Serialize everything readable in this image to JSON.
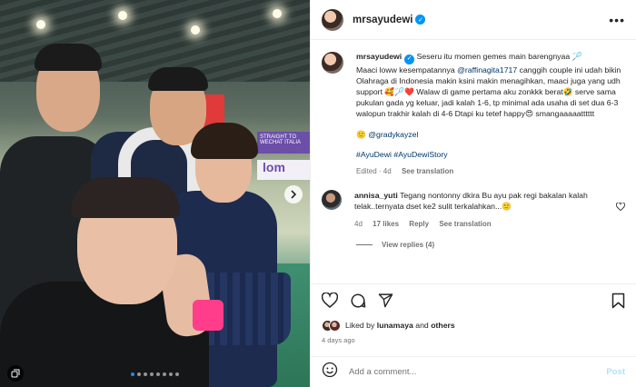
{
  "post": {
    "username": "mrsayudewi",
    "caption_segments": {
      "line_a": "Seseru itu momen gemes main barengnyaa 🏸",
      "line_b": "Maaci loww kesempatannya ",
      "mention_raffi": "@raffinagita1717",
      "line_c": " canggih couple ini udah bikin Olahraga di Indonesia makin ksini makin menagihkan, maaci juga yang udh support 🥰🏸❤️ Walaw di game pertama aku zonkkk berat🤣 serve sama pukulan gada yg keluar, jadi kalah 1-6, tp minimal ada usaha di set dua 6-3 walopun trakhir kalah di 4-6 Dtapi ku tetef happy😍 smangaaaaatttttt",
      "line_d": "🙂 ",
      "mention_grady": "@gradykayzel",
      "hashtags": "#AyuDewi #AyuDewiStory"
    },
    "caption_meta": {
      "edited": "Edited · 4d",
      "see_translation": "See translation"
    }
  },
  "comments": [
    {
      "username": "annisa_yuti",
      "text": "Tegang nontonny dkira Bu ayu pak regi bakalan kalah telak..ternyata dset ke2 sulit terkalahkan...🙂",
      "age": "4d",
      "likes": "17 likes",
      "reply": "Reply",
      "see_translation": "See translation",
      "view_replies": "View replies (4)"
    }
  ],
  "likes": {
    "prefix": "Liked by ",
    "user": "lunamaya",
    "mid": " and ",
    "others": "others"
  },
  "timestamp": "4 days ago",
  "add_comment": {
    "placeholder": "Add a comment...",
    "post_label": "Post"
  },
  "photo": {
    "banner_text": "STRAIGHT TO WECHAT ITALIA",
    "banner_brand": "lom",
    "carousel_count": 8,
    "carousel_active": 0
  },
  "colors": {
    "link": "#00376b",
    "verified": "#0095f6",
    "post_disabled": "#b2dffc",
    "wristband": "#ff3d8b"
  },
  "icons": [
    "more-icon",
    "verified-icon",
    "heart-icon",
    "comment-icon",
    "share-icon",
    "bookmark-icon",
    "emoji-icon",
    "next-arrow-icon",
    "carousel-multi-icon"
  ]
}
